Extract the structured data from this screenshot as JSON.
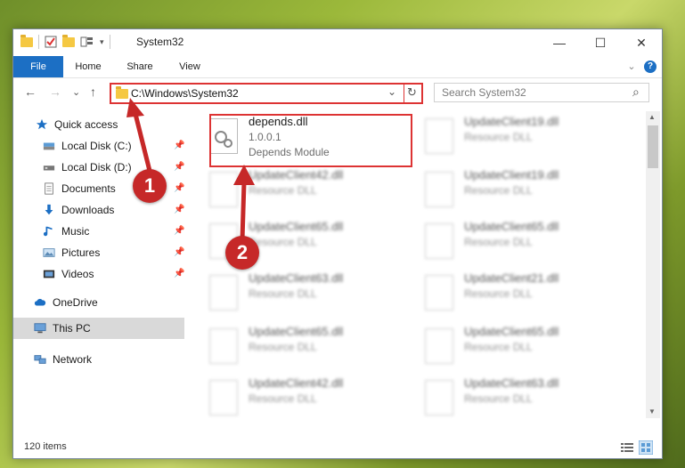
{
  "window": {
    "title": "System32",
    "minimize": "—",
    "maximize": "☐",
    "close": "✕"
  },
  "ribbon": {
    "tabs": [
      "File",
      "Home",
      "Share",
      "View"
    ],
    "collapse": "⌄",
    "help": "?"
  },
  "address_bar": {
    "path": "C:\\Windows\\System32",
    "dropdown": "⌄",
    "refresh": "↻"
  },
  "search": {
    "placeholder": "Search System32",
    "icon_glyph": "⌕"
  },
  "nav_buttons": {
    "back": "←",
    "forward": "→",
    "recent": "⌄",
    "up": "↑"
  },
  "sidebar": {
    "quick_access": "Quick access",
    "items": [
      {
        "label": "Local Disk (C:)",
        "pinned": true
      },
      {
        "label": "Local Disk (D:)",
        "pinned": true
      },
      {
        "label": "Documents",
        "pinned": true
      },
      {
        "label": "Downloads",
        "pinned": true
      },
      {
        "label": "Music",
        "pinned": true
      },
      {
        "label": "Pictures",
        "pinned": true
      },
      {
        "label": "Videos",
        "pinned": true
      }
    ],
    "onedrive": "OneDrive",
    "this_pc": "This PC",
    "network": "Network",
    "pin_glyph": "📌"
  },
  "files": [
    {
      "name": "depends.dll",
      "line2": "1.0.0.1",
      "line3": "Depends Module"
    },
    {
      "name": "UpdateClient19.dll",
      "line2": "Resource DLL"
    },
    {
      "name": "UpdateClient42.dll",
      "line2": "Resource DLL"
    },
    {
      "name": "UpdateClient19.dll",
      "line2": "Resource DLL"
    },
    {
      "name": "UpdateClient65.dll",
      "line2": "Resource DLL"
    },
    {
      "name": "UpdateClient65.dll",
      "line2": "Resource DLL"
    },
    {
      "name": "UpdateClient63.dll",
      "line2": "Resource DLL"
    },
    {
      "name": "UpdateClient21.dll",
      "line2": "Resource DLL"
    },
    {
      "name": "UpdateClient65.dll",
      "line2": "Resource DLL"
    },
    {
      "name": "UpdateClient65.dll",
      "line2": "Resource DLL"
    },
    {
      "name": "UpdateClient42.dll",
      "line2": "Resource DLL"
    },
    {
      "name": "UpdateClient63.dll",
      "line2": "Resource DLL"
    }
  ],
  "status": {
    "item_count": "120 items"
  },
  "annotations": {
    "marker1": "1",
    "marker2": "2",
    "color": "#c62828"
  },
  "colors": {
    "accent": "#1c6fc4",
    "highlight_box": "#dd3333"
  }
}
